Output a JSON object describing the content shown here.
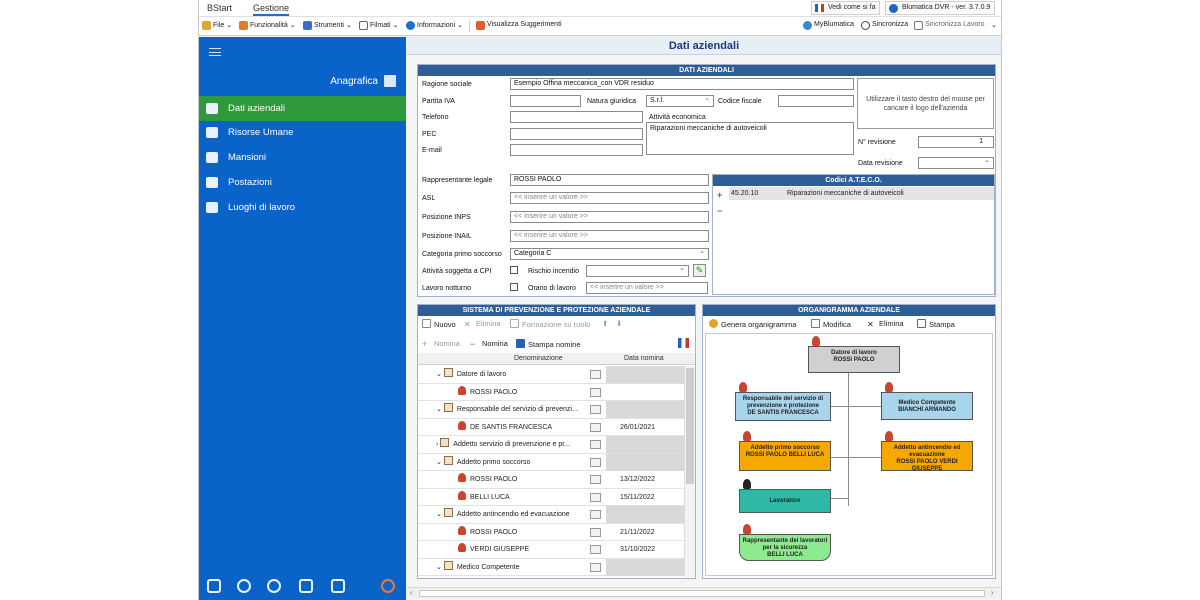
{
  "top_tabs": [
    "BStart",
    "Gestione"
  ],
  "top_right": {
    "what_it_does": "Vedi come si fa",
    "app_version": "Blumatica DVR - ver. 3.7.0.9"
  },
  "toolbar": {
    "items": [
      "File",
      "Funzionalità",
      "Strumenti",
      "Filmati",
      "Informazioni",
      "Visualizza Suggerimenti"
    ],
    "right": [
      "MyBlumatica",
      "Sincronizza",
      "Sincronizza Lavoro"
    ]
  },
  "sidebar": {
    "section": "Anagrafica",
    "items": [
      {
        "label": "Dati aziendali",
        "icon": "id-card-icon"
      },
      {
        "label": "Risorse Umane",
        "icon": "people-icon"
      },
      {
        "label": "Mansioni",
        "icon": "task-list-icon"
      },
      {
        "label": "Postazioni",
        "icon": "workstation-icon"
      },
      {
        "label": "Luoghi di lavoro",
        "icon": "location-icon"
      }
    ],
    "bottom_icons": [
      "building-icon",
      "tools-icon",
      "gear-person-icon",
      "edit-icon",
      "print-icon",
      "settings-cog-icon"
    ]
  },
  "page_title": "Dati aziendali",
  "company": {
    "panel_title": "DATI AZIENDALI",
    "labels": {
      "ragione_sociale": "Ragione sociale",
      "partita_iva": "Partita IVA",
      "natura_giuridica": "Natura giuridica",
      "codice_fiscale": "Codice fiscale",
      "telefono": "Telefono",
      "attivita_economica": "Attività economica",
      "pec": "PEC",
      "email": "E-mail",
      "n_revisione": "N° revisione",
      "data_revisione": "Data revisione",
      "rappresentante": "Rappresentante legale",
      "asl": "ASL",
      "inps": "Posizione INPS",
      "inail": "Posizione INAIL",
      "primo_soccorso": "Categoria primo soccorso",
      "cpi": "Attività soggetta a CPI",
      "rischio": "Rischio incendio",
      "notturno": "Lavoro notturno",
      "orario": "Orario di lavoro"
    },
    "values": {
      "ragione_sociale": "Esempio Offina meccanica_con VDR residuo",
      "natura_giuridica": "S.r.l.",
      "attivita_economica": "Riparazioni meccaniche di autoveicoli",
      "n_revisione": "1",
      "rappresentante": "ROSSI PAOLO",
      "primo_soccorso": "Categoria C"
    },
    "placeholder": "<< inserire un valore >>",
    "logo_hint": "Utilizzare il tasto destro del mouse per cancare il logo dell'azienda",
    "ateco": {
      "title": "Codici A.T.E.C.O.",
      "code": "45.20.10",
      "desc": "Riparazioni meccaniche di autoveicoli"
    }
  },
  "sppa": {
    "title": "SISTEMA DI PREVENZIONE E PROTEZIONE AZIENDALE",
    "toolbar": [
      "Nuovo",
      "Elimina",
      "Formazione su ruolo"
    ],
    "toolbar2": [
      "Nomina",
      "Nomina",
      "Stampa nomine"
    ],
    "columns": [
      "Denominazione",
      "Data nomina"
    ],
    "rows": [
      {
        "type": "group",
        "name": "Datore di lavoro",
        "date": ""
      },
      {
        "type": "person",
        "name": "ROSSI PAOLO",
        "date": ""
      },
      {
        "type": "group",
        "name": "Responsabile del servizio di prevenzi...",
        "date": ""
      },
      {
        "type": "person",
        "name": "DE SANTIS FRANCESCA",
        "date": "26/01/2021"
      },
      {
        "type": "group",
        "name": "Addetto servizio di prevenzione e pr...",
        "date": ""
      },
      {
        "type": "group",
        "name": "Addetto primo soccorso",
        "date": ""
      },
      {
        "type": "person",
        "name": "ROSSI PAOLO",
        "date": "13/12/2022"
      },
      {
        "type": "person",
        "name": "BELLI LUCA",
        "date": "15/11/2022"
      },
      {
        "type": "group",
        "name": "Addetto antincendio ed evacuazione",
        "date": ""
      },
      {
        "type": "person",
        "name": "ROSSI PAOLO",
        "date": "21/11/2022"
      },
      {
        "type": "person",
        "name": "VERDI GIUSEPPE",
        "date": "31/10/2022"
      },
      {
        "type": "group",
        "name": "Medico Competente",
        "date": ""
      }
    ]
  },
  "org": {
    "title": "ORGANIGRAMMA AZIENDALE",
    "toolbar": [
      "Genera organigramma",
      "Modifica",
      "Elimina",
      "Stampa"
    ],
    "nodes": {
      "datore": {
        "title": "Datore di lavoro",
        "names": "ROSSI PAOLO"
      },
      "rspp": {
        "title": "Responsabile del servizio di prevenzione e protezione",
        "names": "DE SANTIS FRANCESCA"
      },
      "medico": {
        "title": "Medico Competente",
        "names": "BIANCHI ARMANDO"
      },
      "primo": {
        "title": "Addetto primo soccorso",
        "names": "ROSSI PAOLO BELLI LUCA"
      },
      "antincendio": {
        "title": "Addetto antincendio ed evacuazione",
        "names": "ROSSI PAOLO VERDI GIUSEPPE"
      },
      "lavoratore": {
        "title": "Lavoratore",
        "names": ""
      },
      "rls": {
        "title": "Rappresentante dei lavoratori per la sicurezza",
        "names": "BELLI LUCA"
      }
    }
  }
}
